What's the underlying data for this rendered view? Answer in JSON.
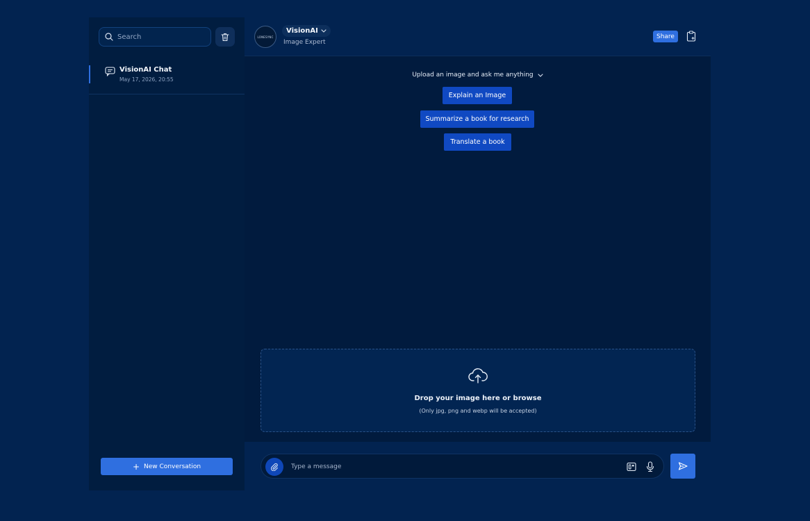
{
  "sidebar": {
    "search_placeholder": "Search",
    "conversations": [
      {
        "title": "VisionAI Chat",
        "date": "May 17, 2026, 20:55"
      }
    ],
    "new_conversation_label": "New Conversation"
  },
  "header": {
    "logo_text": "LONESYNC",
    "model_name": "VisionAI",
    "model_subtitle": "Image Expert",
    "share_label": "Share"
  },
  "main": {
    "suggestion_title": "Upload an image and ask me anything",
    "suggestions": [
      "Explain an Image",
      "Summarize a book for research",
      "Translate a book"
    ],
    "dropzone": {
      "title": "Drop your image here or browse",
      "subtitle": "(Only jpg, png and webp will be accepted)"
    }
  },
  "composer": {
    "placeholder": "Type a message"
  },
  "icons": {
    "search": "search-icon",
    "trash": "trash-icon",
    "chat": "chat-bubble-icon",
    "plus": "plus-icon",
    "chevron": "chevron-down-icon",
    "clipboard": "clipboard-icon",
    "upload": "cloud-upload-icon",
    "attach": "paperclip-icon",
    "keyboard": "keyboard-icon",
    "mic": "microphone-icon",
    "send": "send-icon"
  },
  "colors": {
    "background": "#022350",
    "panel": "#011b3e",
    "accent": "#2f6fe0",
    "suggestion": "#1049c2"
  }
}
